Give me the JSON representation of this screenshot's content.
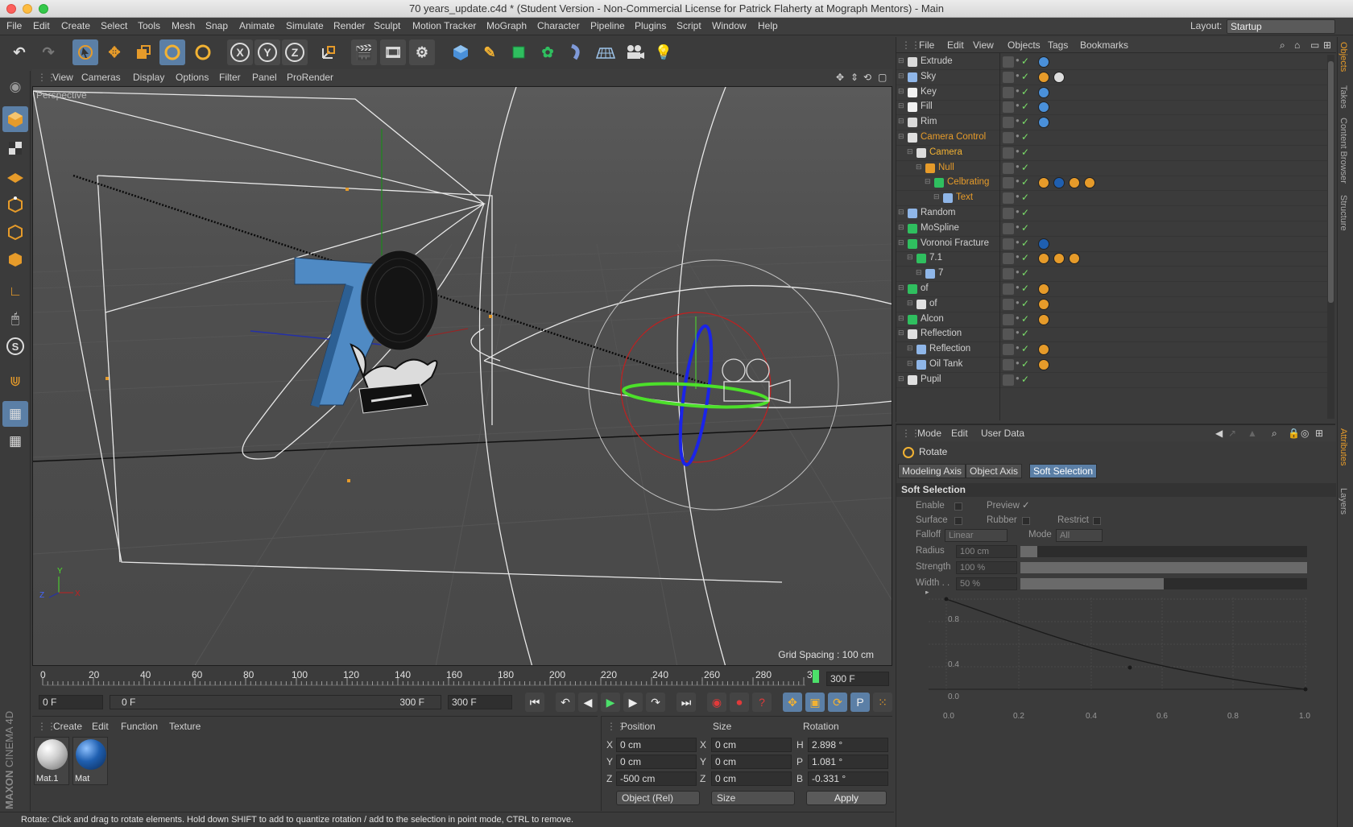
{
  "window": {
    "title": "70 years_update.c4d * (Student Version - Non-Commercial License for Patrick Flaherty at Mograph Mentors) - Main"
  },
  "menubar": {
    "items": [
      "File",
      "Edit",
      "Create",
      "Select",
      "Tools",
      "Mesh",
      "Snap",
      "Animate",
      "Simulate",
      "Render",
      "Sculpt",
      "Motion Tracker",
      "MoGraph",
      "Character",
      "Pipeline",
      "Plugins",
      "Script",
      "Window",
      "Help"
    ],
    "layout_label": "Layout:",
    "layout_value": "Startup"
  },
  "toolbar": {
    "icons": [
      "undo-icon",
      "redo-icon",
      "select-arrow-icon",
      "move-icon",
      "scale-icon",
      "rotate-icon",
      "recent-tool-icon",
      "x-axis-lock-icon",
      "y-axis-lock-icon",
      "z-axis-lock-icon",
      "coordinate-system-icon",
      "render-view-icon",
      "render-picture-viewer-icon",
      "edit-render-settings-icon",
      "cube-icon",
      "pen-spline-icon",
      "subdivision-icon",
      "cloner-icon",
      "deformer-icon",
      "floor-icon",
      "camera-icon",
      "light-icon"
    ],
    "axis_labels": [
      "X",
      "Y",
      "Z"
    ]
  },
  "viewport": {
    "menu": [
      "View",
      "Cameras",
      "Display",
      "Options",
      "Filter",
      "Panel",
      "ProRender"
    ],
    "label": "Perspective",
    "grid_spacing": "Grid Spacing : 100 cm"
  },
  "timeline": {
    "ticks": [
      "0",
      "20",
      "40",
      "60",
      "80",
      "100",
      "120",
      "140",
      "160",
      "180",
      "200",
      "220",
      "240",
      "260",
      "280",
      "3"
    ],
    "current_frame": "300 F"
  },
  "transport": {
    "start": "0 F",
    "slider_left": "0 F",
    "slider_right": "300 F",
    "end": "300 F"
  },
  "materials": {
    "menu": [
      "Create",
      "Edit",
      "Function",
      "Texture"
    ],
    "items": [
      {
        "label": "Mat.1",
        "color": "#d9d9d9"
      },
      {
        "label": "Mat",
        "color": "#1f5fb0"
      }
    ]
  },
  "coords": {
    "headers": [
      "Position",
      "Size",
      "Rotation"
    ],
    "rows": [
      {
        "axis": "X",
        "pos": "0 cm",
        "size_axis": "X",
        "size": "0 cm",
        "rot_axis": "H",
        "rot": "2.898 °"
      },
      {
        "axis": "Y",
        "pos": "0 cm",
        "size_axis": "Y",
        "size": "0 cm",
        "rot_axis": "P",
        "rot": "1.081 °"
      },
      {
        "axis": "Z",
        "pos": "-500 cm",
        "size_axis": "Z",
        "size": "0 cm",
        "rot_axis": "B",
        "rot": "-0.331 °"
      }
    ],
    "mode": "Object (Rel)",
    "size_mode": "Size",
    "apply": "Apply"
  },
  "status": "Rotate: Click and drag to rotate elements. Hold down SHIFT to add to quantize rotation / add to the selection in point mode, CTRL to remove.",
  "brand": {
    "maxon": "MAXON",
    "product": "CINEMA 4D"
  },
  "objects": {
    "menu": [
      "File",
      "Edit",
      "View",
      "Objects",
      "Tags",
      "Bookmarks"
    ],
    "rows": [
      {
        "name": "Extrude",
        "indent": 0,
        "color": "#d0d0d0"
      },
      {
        "name": "Sky",
        "indent": 0,
        "color": "#d0d0d0"
      },
      {
        "name": "Key",
        "indent": 0,
        "color": "#d0d0d0"
      },
      {
        "name": "Fill",
        "indent": 0,
        "color": "#d0d0d0"
      },
      {
        "name": "Rim",
        "indent": 0,
        "color": "#d0d0d0"
      },
      {
        "name": "Camera Control",
        "indent": 0,
        "color": "#e69b2a"
      },
      {
        "name": "Camera",
        "indent": 1,
        "color": "#f2b233"
      },
      {
        "name": "Null",
        "indent": 2,
        "color": "#e69b2a"
      },
      {
        "name": "Celbrating",
        "indent": 3,
        "color": "#e69b2a"
      },
      {
        "name": "Text",
        "indent": 4,
        "color": "#e69b2a"
      },
      {
        "name": "Random",
        "indent": 0,
        "color": "#d0d0d0"
      },
      {
        "name": "MoSpline",
        "indent": 0,
        "color": "#d0d0d0"
      },
      {
        "name": "Voronoi Fracture",
        "indent": 0,
        "color": "#d0d0d0"
      },
      {
        "name": "7.1",
        "indent": 1,
        "color": "#d0d0d0"
      },
      {
        "name": "7",
        "indent": 2,
        "color": "#d0d0d0"
      },
      {
        "name": "of",
        "indent": 0,
        "color": "#d0d0d0"
      },
      {
        "name": "of",
        "indent": 1,
        "color": "#d0d0d0"
      },
      {
        "name": "Alcon",
        "indent": 0,
        "color": "#d0d0d0"
      },
      {
        "name": "Reflection",
        "indent": 0,
        "color": "#d0d0d0"
      },
      {
        "name": "Reflection",
        "indent": 1,
        "color": "#d0d0d0"
      },
      {
        "name": "Oil Tank",
        "indent": 1,
        "color": "#d0d0d0"
      },
      {
        "name": "Pupil",
        "indent": 0,
        "color": "#d0d0d0"
      }
    ]
  },
  "attributes": {
    "menu": [
      "Mode",
      "Edit",
      "User Data"
    ],
    "title": "Rotate",
    "tabs": [
      "Modeling Axis",
      "Object Axis",
      "Soft Selection"
    ],
    "active_tab": "Soft Selection",
    "section": "Soft Selection",
    "enable": "Enable",
    "preview": "Preview",
    "surface": "Surface",
    "rubber": "Rubber",
    "restrict": "Restrict",
    "falloff_label": "Falloff",
    "falloff": "Linear",
    "mode_label": "Mode",
    "mode": "All",
    "radius_label": "Radius",
    "radius": "100 cm",
    "radius_fill": 0.06,
    "strength_label": "Strength",
    "strength": "100 %",
    "strength_fill": 1.0,
    "width_label": "Width . .",
    "width": "50 %",
    "width_fill": 0.5,
    "graph_y_ticks": [
      "0.8",
      "0.4",
      "0.0"
    ],
    "graph_x_ticks": [
      "0.0",
      "0.2",
      "0.4",
      "0.6",
      "0.8",
      "1.0"
    ]
  },
  "right_tabs": [
    "Objects",
    "Takes",
    "Content Browser",
    "Structure",
    "Attributes",
    "Layers"
  ]
}
